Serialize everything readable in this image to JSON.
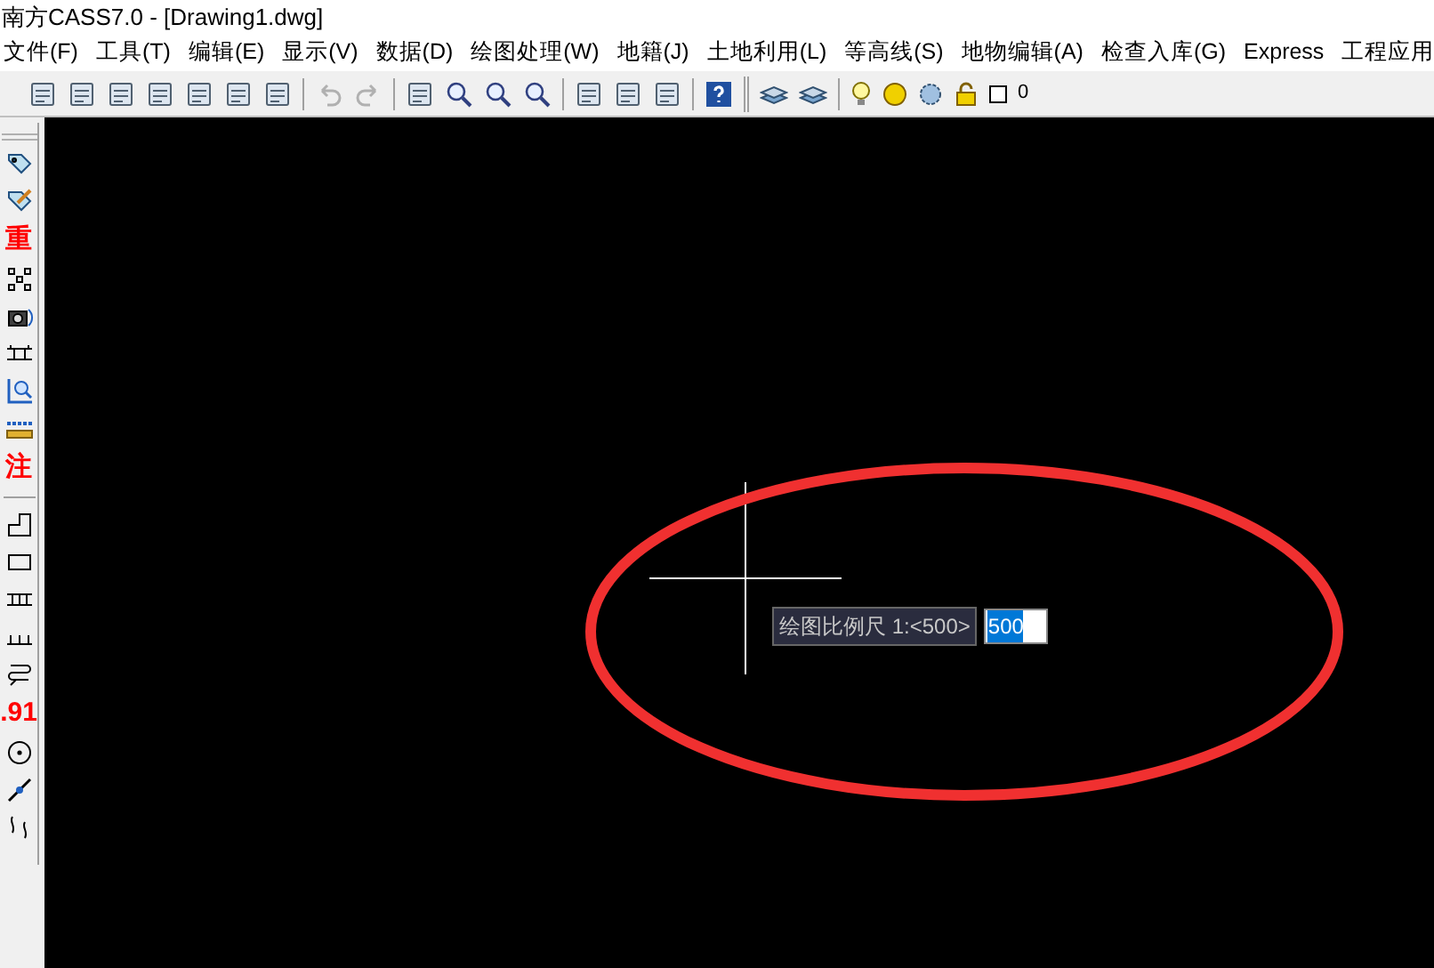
{
  "window": {
    "title": "南方CASS7.0 - [Drawing1.dwg]"
  },
  "menu": [
    {
      "label": "文件(F)"
    },
    {
      "label": "工具(T)"
    },
    {
      "label": "编辑(E)"
    },
    {
      "label": "显示(V)"
    },
    {
      "label": "数据(D)"
    },
    {
      "label": "绘图处理(W)"
    },
    {
      "label": "地籍(J)"
    },
    {
      "label": "土地利用(L)"
    },
    {
      "label": "等高线(S)"
    },
    {
      "label": "地物编辑(A)"
    },
    {
      "label": "检查入库(G)"
    },
    {
      "label": "Express"
    },
    {
      "label": "工程应用"
    }
  ],
  "toolbar": {
    "layer": "0"
  },
  "side_toolbar": [
    {
      "kind": "tag"
    },
    {
      "kind": "pencil"
    },
    {
      "kind": "glyph",
      "text": "重"
    },
    {
      "kind": "dots"
    },
    {
      "kind": "camera"
    },
    {
      "kind": "ticks"
    },
    {
      "kind": "zoom"
    },
    {
      "kind": "ruler"
    },
    {
      "kind": "glyph",
      "text": "注"
    },
    {
      "kind": "separator"
    },
    {
      "kind": "step"
    },
    {
      "kind": "rect"
    },
    {
      "kind": "ladder"
    },
    {
      "kind": "comb"
    },
    {
      "kind": "coil"
    },
    {
      "kind": "glyph",
      "text": ".91"
    },
    {
      "kind": "circle"
    },
    {
      "kind": "line"
    },
    {
      "kind": "wave"
    }
  ],
  "command": {
    "prompt": "绘图比例尺 1:<500>",
    "value": "500",
    "value_selected": true
  }
}
